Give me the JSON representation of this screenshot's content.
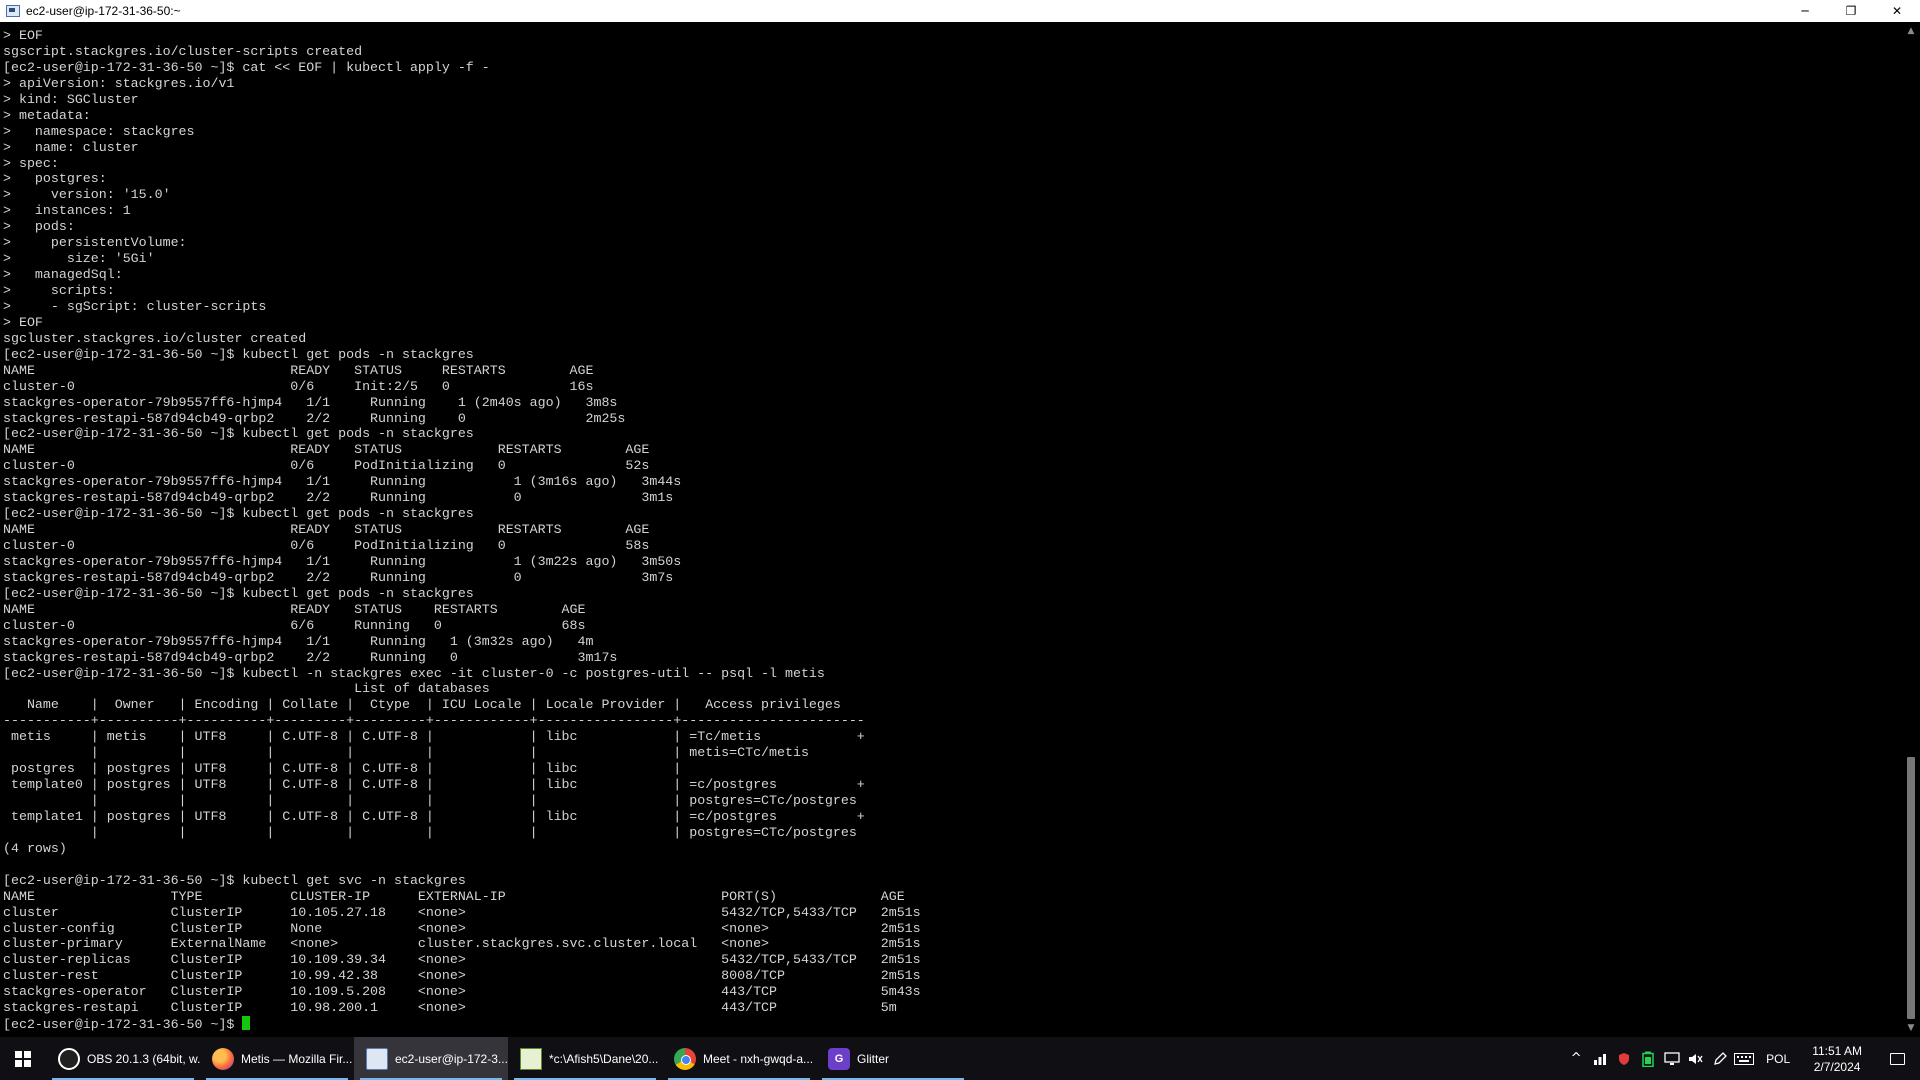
{
  "window": {
    "title": "ec2-user@ip-172-31-36-50:~",
    "controls": {
      "minimize": "─",
      "restore": "❐",
      "close": "✕"
    }
  },
  "terminal": {
    "lines": [
      "> EOF",
      "sgscript.stackgres.io/cluster-scripts created",
      "[ec2-user@ip-172-31-36-50 ~]$ cat << EOF | kubectl apply -f -",
      "> apiVersion: stackgres.io/v1",
      "> kind: SGCluster",
      "> metadata:",
      ">   namespace: stackgres",
      ">   name: cluster",
      "> spec:",
      ">   postgres:",
      ">     version: '15.0'",
      ">   instances: 1",
      ">   pods:",
      ">     persistentVolume:",
      ">       size: '5Gi'",
      ">   managedSql:",
      ">     scripts:",
      ">     - sgScript: cluster-scripts",
      "> EOF",
      "sgcluster.stackgres.io/cluster created",
      "[ec2-user@ip-172-31-36-50 ~]$ kubectl get pods -n stackgres",
      "NAME                                READY   STATUS     RESTARTS        AGE",
      "cluster-0                           0/6     Init:2/5   0               16s",
      "stackgres-operator-79b9557ff6-hjmp4   1/1     Running    1 (2m40s ago)   3m8s",
      "stackgres-restapi-587d94cb49-qrbp2    2/2     Running    0               2m25s",
      "[ec2-user@ip-172-31-36-50 ~]$ kubectl get pods -n stackgres",
      "NAME                                READY   STATUS            RESTARTS        AGE",
      "cluster-0                           0/6     PodInitializing   0               52s",
      "stackgres-operator-79b9557ff6-hjmp4   1/1     Running           1 (3m16s ago)   3m44s",
      "stackgres-restapi-587d94cb49-qrbp2    2/2     Running           0               3m1s",
      "[ec2-user@ip-172-31-36-50 ~]$ kubectl get pods -n stackgres",
      "NAME                                READY   STATUS            RESTARTS        AGE",
      "cluster-0                           0/6     PodInitializing   0               58s",
      "stackgres-operator-79b9557ff6-hjmp4   1/1     Running           1 (3m22s ago)   3m50s",
      "stackgres-restapi-587d94cb49-qrbp2    2/2     Running           0               3m7s",
      "[ec2-user@ip-172-31-36-50 ~]$ kubectl get pods -n stackgres",
      "NAME                                READY   STATUS    RESTARTS        AGE",
      "cluster-0                           6/6     Running   0               68s",
      "stackgres-operator-79b9557ff6-hjmp4   1/1     Running   1 (3m32s ago)   4m",
      "stackgres-restapi-587d94cb49-qrbp2    2/2     Running   0               3m17s",
      "[ec2-user@ip-172-31-36-50 ~]$ kubectl -n stackgres exec -it cluster-0 -c postgres-util -- psql -l metis",
      "                                            List of databases",
      "   Name    |  Owner   | Encoding | Collate |  Ctype  | ICU Locale | Locale Provider |   Access privileges",
      "-----------+----------+----------+---------+---------+------------+-----------------+-----------------------",
      " metis     | metis    | UTF8     | C.UTF-8 | C.UTF-8 |            | libc            | =Tc/metis            +",
      "           |          |          |         |         |            |                 | metis=CTc/metis",
      " postgres  | postgres | UTF8     | C.UTF-8 | C.UTF-8 |            | libc            |",
      " template0 | postgres | UTF8     | C.UTF-8 | C.UTF-8 |            | libc            | =c/postgres          +",
      "           |          |          |         |         |            |                 | postgres=CTc/postgres",
      " template1 | postgres | UTF8     | C.UTF-8 | C.UTF-8 |            | libc            | =c/postgres          +",
      "           |          |          |         |         |            |                 | postgres=CTc/postgres",
      "(4 rows)",
      "",
      "[ec2-user@ip-172-31-36-50 ~]$ kubectl get svc -n stackgres",
      "NAME                 TYPE           CLUSTER-IP      EXTERNAL-IP                           PORT(S)             AGE",
      "cluster              ClusterIP      10.105.27.18    <none>                                5432/TCP,5433/TCP   2m51s",
      "cluster-config       ClusterIP      None            <none>                                <none>              2m51s",
      "cluster-primary      ExternalName   <none>          cluster.stackgres.svc.cluster.local   <none>              2m51s",
      "cluster-replicas     ClusterIP      10.109.39.34    <none>                                5432/TCP,5433/TCP   2m51s",
      "cluster-rest         ClusterIP      10.99.42.38     <none>                                8008/TCP            2m51s",
      "stackgres-operator   ClusterIP      10.109.5.208    <none>                                443/TCP             5m43s",
      "stackgres-restapi    ClusterIP      10.98.200.1     <none>                                443/TCP             5m"
    ],
    "prompt": "[ec2-user@ip-172-31-36-50 ~]$ ",
    "cursor_color": "#16c60c",
    "text_color": "#d4d4d4",
    "background": "#000000"
  },
  "taskbar": {
    "items": [
      {
        "label": "OBS 20.1.3 (64bit, w...",
        "icon": "obs-icon",
        "active": false
      },
      {
        "label": "Metis — Mozilla Fir...",
        "icon": "firefox-icon",
        "active": false
      },
      {
        "label": "ec2-user@ip-172-3...",
        "icon": "terminal-icon",
        "active": true
      },
      {
        "label": "*c:\\Afish5\\Dane\\20...",
        "icon": "notepad-icon",
        "active": false
      },
      {
        "label": "Meet - nxh-gwqd-a...",
        "icon": "chrome-icon",
        "active": false
      },
      {
        "label": "Glitter",
        "icon": "glitter-icon",
        "active": false
      }
    ],
    "glitter_letter": "G",
    "tray": {
      "chevron": "^",
      "icons": [
        "network-icon",
        "shield-icon",
        "battery-icon",
        "display-icon",
        "volume-icon",
        "pen-icon",
        "keyboard-icon"
      ],
      "language": "POL",
      "time": "11:51 AM",
      "date": "2/7/2024"
    },
    "accent": "#76b9ed",
    "background": "#0f0f14"
  }
}
